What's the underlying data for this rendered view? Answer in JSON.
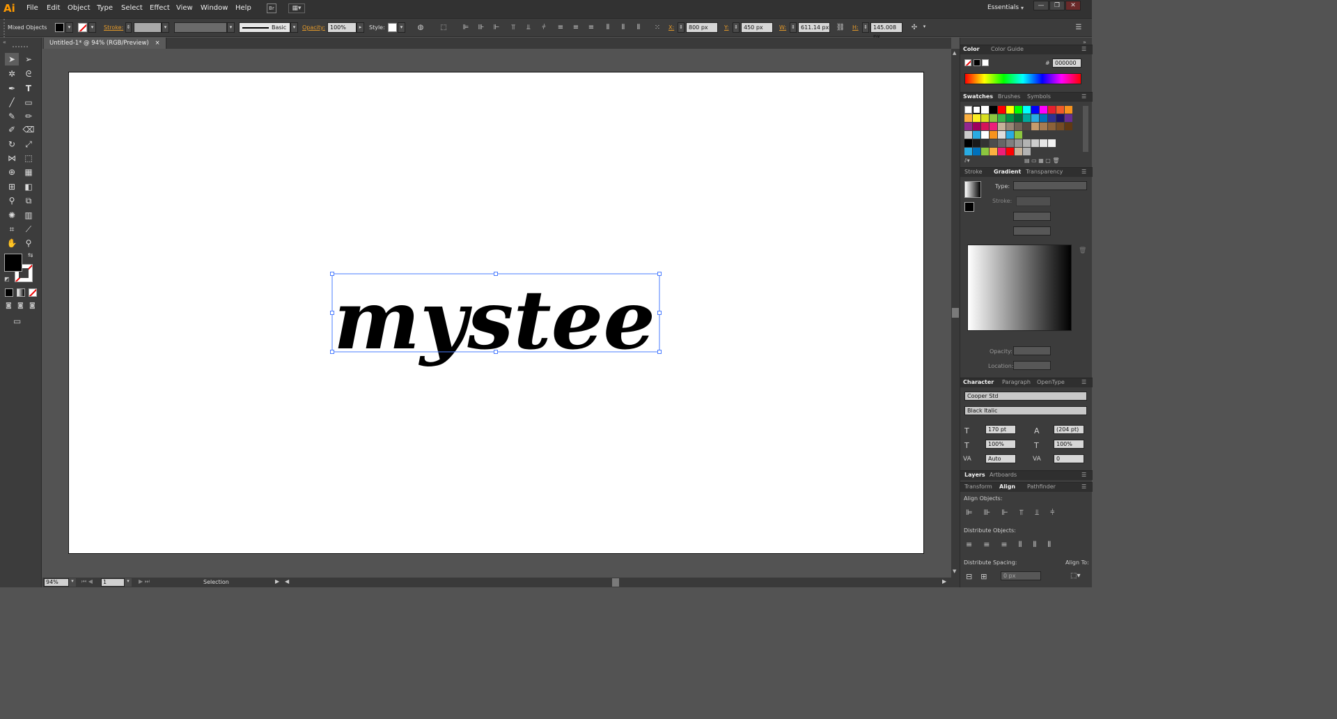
{
  "app": {
    "logo": "Ai",
    "workspace": "Essentials"
  },
  "menu": [
    "File",
    "Edit",
    "Object",
    "Type",
    "Select",
    "Effect",
    "View",
    "Window",
    "Help"
  ],
  "menu_extras": {
    "bridge": "Br"
  },
  "window_controls": [
    "—",
    "❐",
    "✕"
  ],
  "control_bar": {
    "selection_type": "Mixed Objects",
    "stroke_label": "Stroke:",
    "brush_style": "Basic",
    "opacity_label": "Opacity:",
    "opacity_value": "100%",
    "style_label": "Style:",
    "x_label": "X:",
    "x_value": "800 px",
    "y_label": "Y:",
    "y_value": "450 px",
    "w_label": "W:",
    "w_value": "611.14 px",
    "h_label": "H:",
    "h_value": "145.008 px"
  },
  "document": {
    "tab_title": "Untitled-1* @ 94% (RGB/Preview)",
    "close": "×"
  },
  "artwork": {
    "text": "mystee",
    "fill_color": "#000000",
    "selection_color": "#4a7cff"
  },
  "status_bar": {
    "zoom": "94%",
    "artboard_number": "1",
    "tool_status": "Selection"
  },
  "panels": {
    "color": {
      "tabs": [
        "Color",
        "Color Guide"
      ],
      "hex_label": "#",
      "hex_value": "000000"
    },
    "swatches": {
      "tabs": [
        "Swatches",
        "Brushes",
        "Symbols"
      ]
    },
    "gradient": {
      "tabs": [
        "Stroke",
        "Gradient",
        "Transparency"
      ],
      "type_label": "Type:",
      "stroke_label": "Stroke:",
      "opacity_label": "Opacity:",
      "location_label": "Location:"
    },
    "character": {
      "tabs": [
        "Character",
        "Paragraph",
        "OpenType"
      ],
      "font_family": "Cooper Std",
      "font_style": "Black Italic",
      "size": "170 pt",
      "leading": "(204 pt)",
      "vscale": "100%",
      "hscale": "100%",
      "kerning": "Auto",
      "tracking": "0"
    },
    "layers": {
      "tabs": [
        "Layers",
        "Artboards"
      ]
    },
    "align": {
      "tabs": [
        "Transform",
        "Align",
        "Pathfinder"
      ],
      "align_objects": "Align Objects:",
      "distribute_objects": "Distribute Objects:",
      "distribute_spacing": "Distribute Spacing:",
      "align_to": "Align To:",
      "spacing_value": "0 px"
    }
  }
}
